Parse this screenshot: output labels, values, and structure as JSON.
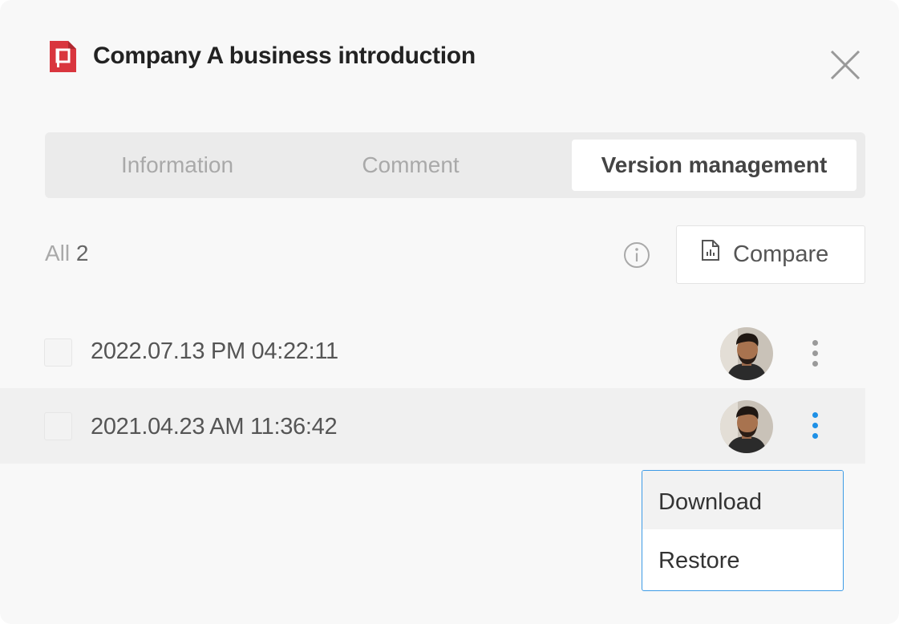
{
  "dialog": {
    "title": "Company A business introduction",
    "file_type_icon": "presentation-file-icon",
    "file_icon_letter": "P",
    "file_icon_color": "#d9363e"
  },
  "tabs": [
    {
      "label": "Information",
      "active": false
    },
    {
      "label": "Comment",
      "active": false
    },
    {
      "label": "Version management",
      "active": true
    }
  ],
  "toolbar": {
    "count_label": "All",
    "count_value": "2",
    "info_icon": "info-icon",
    "compare_label": "Compare",
    "compare_icon": "chart-file-icon"
  },
  "versions": [
    {
      "date": "2022.07.13 PM 04:22:11",
      "checked": false,
      "avatar": "user-avatar"
    },
    {
      "date": "2021.04.23 AM 11:36:42",
      "checked": false,
      "avatar": "user-avatar"
    }
  ],
  "context_menu": {
    "items": [
      {
        "label": "Download"
      },
      {
        "label": "Restore"
      }
    ]
  },
  "colors": {
    "accent": "#1e90e6",
    "menu_border": "#3d9be6"
  }
}
